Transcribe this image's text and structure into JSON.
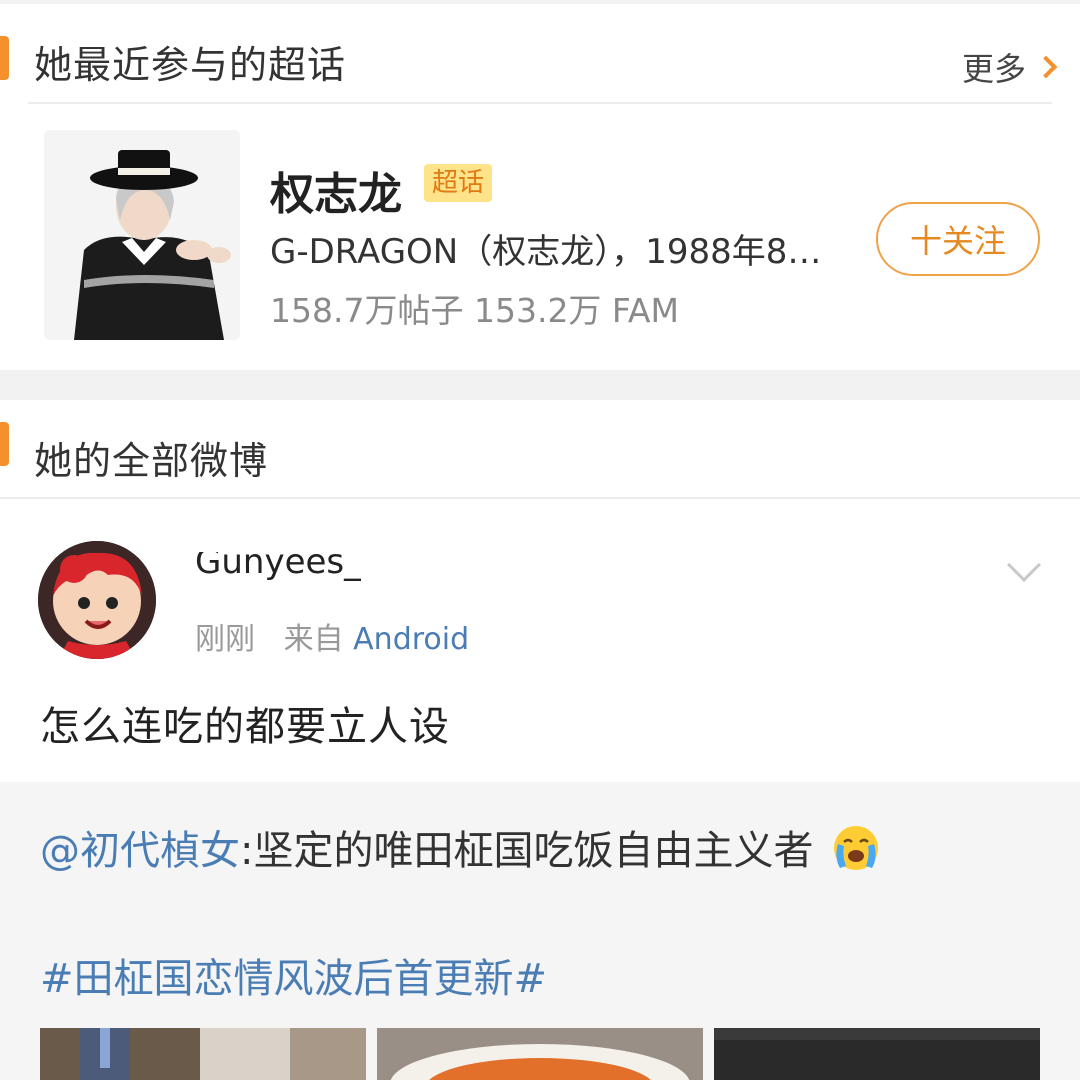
{
  "super_topics": {
    "title": "她最近参与的超话",
    "more_label": "更多",
    "item": {
      "name": "权志龙",
      "badge": "超话",
      "description": "G-DRAGON（权志龙），1988年8…",
      "stats": "158.7万帖子 153.2万 FAM",
      "follow_label": "十关注"
    }
  },
  "all_posts": {
    "title": "她的全部微博"
  },
  "post": {
    "username": "Gunyees_",
    "time": "刚刚",
    "source_prefix": "来自",
    "source": "Android",
    "text": "怎么连吃的都要立人设",
    "repost": {
      "mention": "@初代楨女",
      "text": ":坚定的唯田柾国吃饭自由主义者",
      "emoji": "crying-face-emoji",
      "hashtag": "#田柾国恋情风波后首更新#"
    }
  },
  "colors": {
    "accent": "#f5912c",
    "link": "#4b7db5",
    "badge_bg": "#ffe38a"
  }
}
